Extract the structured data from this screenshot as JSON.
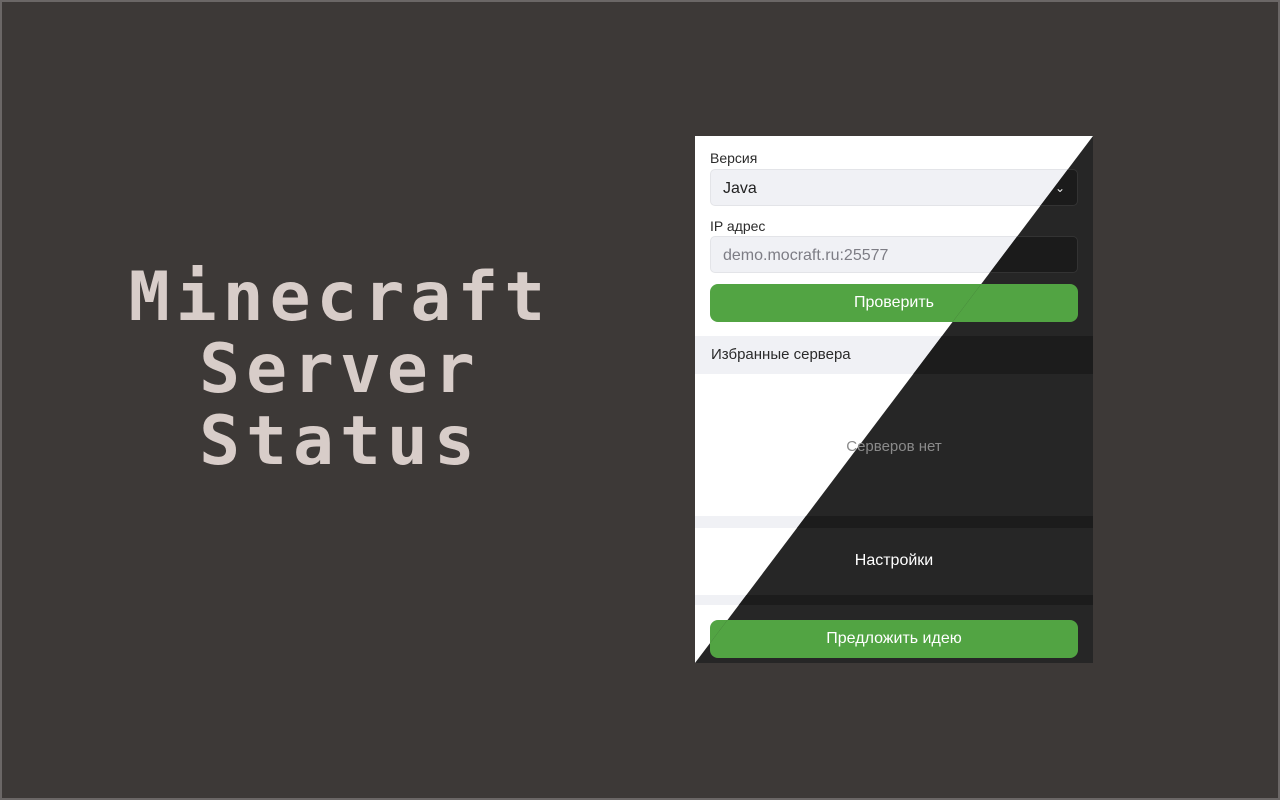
{
  "logo": {
    "line1": "Minecraft",
    "line2": "Server",
    "line3": "Status"
  },
  "popup": {
    "version_label": "Версия",
    "version_value": "Java",
    "ip_label": "IP адрес",
    "ip_placeholder": "demo.mocraft.ru:25577",
    "check_button": "Проверить",
    "favorites_title": "Избранные сервера",
    "favorites_empty": "Серверов нет",
    "settings_label": "Настройки",
    "suggest_button": "Предложить идею"
  },
  "colors": {
    "background": "#3d3937",
    "logo_text": "#d8cdc9",
    "accent_green": "#52a443",
    "light_panel": "#ffffff",
    "dark_panel": "#262626"
  },
  "icons": {
    "select_arrow": "chevron-down-icon"
  }
}
